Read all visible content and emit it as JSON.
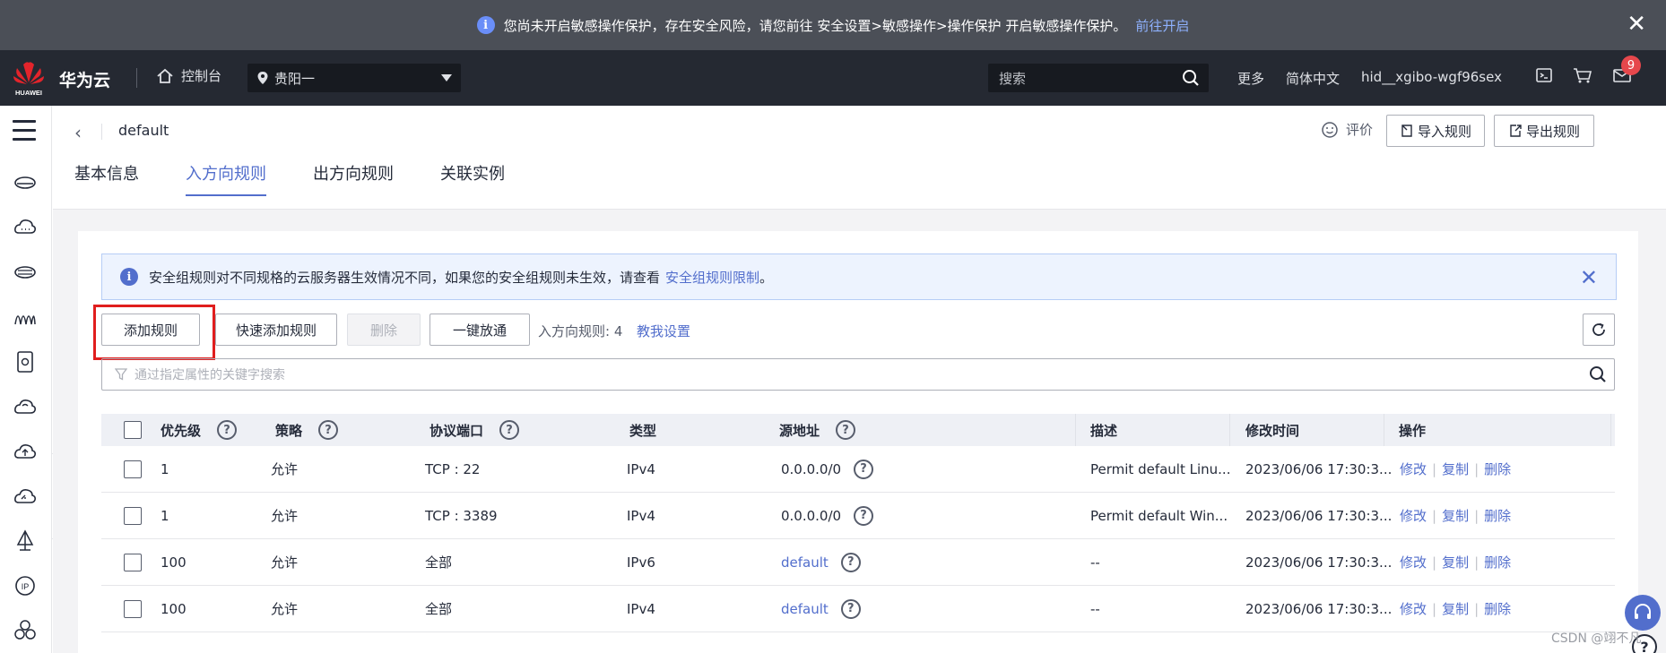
{
  "notice": {
    "text": "您尚未开启敏感操作保护，存在安全风险，请您前往 安全设置>敏感操作>操作保护 开启敏感操作保护。",
    "link": "前往开启",
    "close": "✕"
  },
  "header": {
    "logo_text": "HUAWEI",
    "brand": "华为云",
    "console": "控制台",
    "region": "贵阳一",
    "search_placeholder": "搜索",
    "more": "更多",
    "language": "简体中文",
    "username": "hid__xgibo-wgf96sex",
    "message_count": "9"
  },
  "page": {
    "back": "‹",
    "title": "default",
    "rate": "评价",
    "import_btn": "导入规则",
    "export_btn": "导出规则",
    "tabs": [
      "基本信息",
      "入方向规则",
      "出方向规则",
      "关联实例"
    ],
    "active_tab": 1
  },
  "alert": {
    "text": "安全组规则对不同规格的云服务器生效情况不同，如果您的安全组规则未生效，请查看",
    "link": "安全组规则限制",
    "suffix": "。",
    "close": "✕"
  },
  "toolbar": {
    "add_rule": "添加规则",
    "quick_add": "快速添加规则",
    "delete": "删除",
    "one_click": "一键放通",
    "count_label": "入方向规则: 4",
    "teach": "教我设置"
  },
  "filter": {
    "placeholder": "通过指定属性的关键字搜索"
  },
  "table": {
    "headers": {
      "priority": "优先级",
      "policy": "策略",
      "protocol_port": "协议端口",
      "type": "类型",
      "source": "源地址",
      "description": "描述",
      "modified": "修改时间",
      "actions": "操作"
    },
    "help": "?",
    "actions": {
      "edit": "修改",
      "copy": "复制",
      "delete": "删除",
      "sep": "|"
    },
    "rows": [
      {
        "priority": "1",
        "policy": "允许",
        "protocol_port": "TCP : 22",
        "type": "IPv4",
        "source": "0.0.0.0/0",
        "source_is_link": false,
        "description": "Permit default Linu...",
        "modified": "2023/06/06 17:30:3..."
      },
      {
        "priority": "1",
        "policy": "允许",
        "protocol_port": "TCP : 3389",
        "type": "IPv4",
        "source": "0.0.0.0/0",
        "source_is_link": false,
        "description": "Permit default Win...",
        "modified": "2023/06/06 17:30:3..."
      },
      {
        "priority": "100",
        "policy": "允许",
        "protocol_port": "全部",
        "type": "IPv6",
        "source": "default",
        "source_is_link": true,
        "description": "--",
        "modified": "2023/06/06 17:30:3..."
      },
      {
        "priority": "100",
        "policy": "允许",
        "protocol_port": "全部",
        "type": "IPv4",
        "source": "default",
        "source_is_link": true,
        "description": "--",
        "modified": "2023/06/06 17:30:3..."
      }
    ]
  },
  "watermark": "CSDN @翊不凡",
  "colors": {
    "accent": "#526ecc",
    "notice_bg": "#4b4f57",
    "header_bg": "#252932",
    "highlight": "#e01e1e",
    "badge": "#e6474c"
  }
}
